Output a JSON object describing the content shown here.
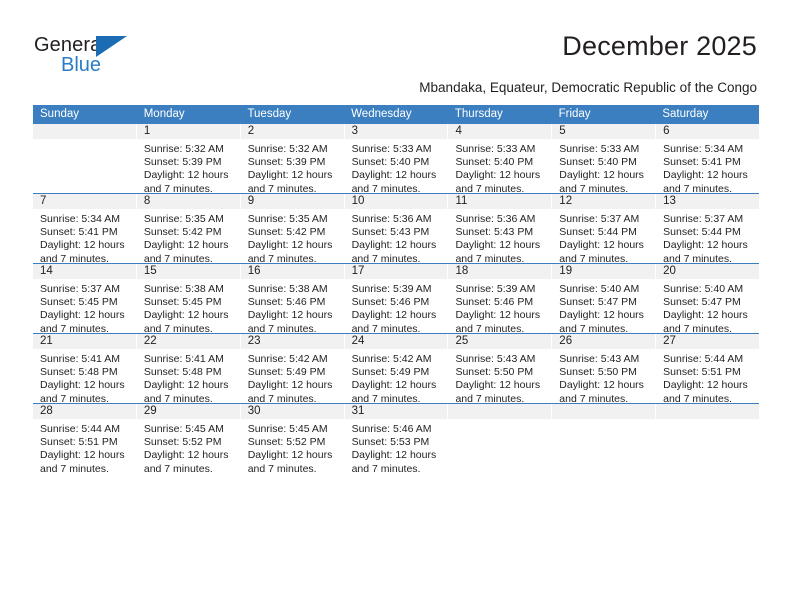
{
  "brand": {
    "name_top": "General",
    "name_bottom": "Blue",
    "accent_color": "#1b6cb3",
    "triangle_icon": "triangle-icon"
  },
  "header": {
    "title": "December 2025",
    "subtitle": "Mbandaka, Equateur, Democratic Republic of the Congo"
  },
  "calendar": {
    "header_bg": "#3b7fc0",
    "daynum_bg": "#f1f1f1",
    "weekdays": [
      "Sunday",
      "Monday",
      "Tuesday",
      "Wednesday",
      "Thursday",
      "Friday",
      "Saturday"
    ],
    "weeks": [
      {
        "days": [
          {
            "num": "",
            "lines": []
          },
          {
            "num": "1",
            "lines": [
              "Sunrise: 5:32 AM",
              "Sunset: 5:39 PM",
              "Daylight: 12 hours",
              "and 7 minutes."
            ]
          },
          {
            "num": "2",
            "lines": [
              "Sunrise: 5:32 AM",
              "Sunset: 5:39 PM",
              "Daylight: 12 hours",
              "and 7 minutes."
            ]
          },
          {
            "num": "3",
            "lines": [
              "Sunrise: 5:33 AM",
              "Sunset: 5:40 PM",
              "Daylight: 12 hours",
              "and 7 minutes."
            ]
          },
          {
            "num": "4",
            "lines": [
              "Sunrise: 5:33 AM",
              "Sunset: 5:40 PM",
              "Daylight: 12 hours",
              "and 7 minutes."
            ]
          },
          {
            "num": "5",
            "lines": [
              "Sunrise: 5:33 AM",
              "Sunset: 5:40 PM",
              "Daylight: 12 hours",
              "and 7 minutes."
            ]
          },
          {
            "num": "6",
            "lines": [
              "Sunrise: 5:34 AM",
              "Sunset: 5:41 PM",
              "Daylight: 12 hours",
              "and 7 minutes."
            ]
          }
        ]
      },
      {
        "days": [
          {
            "num": "7",
            "lines": [
              "Sunrise: 5:34 AM",
              "Sunset: 5:41 PM",
              "Daylight: 12 hours",
              "and 7 minutes."
            ]
          },
          {
            "num": "8",
            "lines": [
              "Sunrise: 5:35 AM",
              "Sunset: 5:42 PM",
              "Daylight: 12 hours",
              "and 7 minutes."
            ]
          },
          {
            "num": "9",
            "lines": [
              "Sunrise: 5:35 AM",
              "Sunset: 5:42 PM",
              "Daylight: 12 hours",
              "and 7 minutes."
            ]
          },
          {
            "num": "10",
            "lines": [
              "Sunrise: 5:36 AM",
              "Sunset: 5:43 PM",
              "Daylight: 12 hours",
              "and 7 minutes."
            ]
          },
          {
            "num": "11",
            "lines": [
              "Sunrise: 5:36 AM",
              "Sunset: 5:43 PM",
              "Daylight: 12 hours",
              "and 7 minutes."
            ]
          },
          {
            "num": "12",
            "lines": [
              "Sunrise: 5:37 AM",
              "Sunset: 5:44 PM",
              "Daylight: 12 hours",
              "and 7 minutes."
            ]
          },
          {
            "num": "13",
            "lines": [
              "Sunrise: 5:37 AM",
              "Sunset: 5:44 PM",
              "Daylight: 12 hours",
              "and 7 minutes."
            ]
          }
        ]
      },
      {
        "days": [
          {
            "num": "14",
            "lines": [
              "Sunrise: 5:37 AM",
              "Sunset: 5:45 PM",
              "Daylight: 12 hours",
              "and 7 minutes."
            ]
          },
          {
            "num": "15",
            "lines": [
              "Sunrise: 5:38 AM",
              "Sunset: 5:45 PM",
              "Daylight: 12 hours",
              "and 7 minutes."
            ]
          },
          {
            "num": "16",
            "lines": [
              "Sunrise: 5:38 AM",
              "Sunset: 5:46 PM",
              "Daylight: 12 hours",
              "and 7 minutes."
            ]
          },
          {
            "num": "17",
            "lines": [
              "Sunrise: 5:39 AM",
              "Sunset: 5:46 PM",
              "Daylight: 12 hours",
              "and 7 minutes."
            ]
          },
          {
            "num": "18",
            "lines": [
              "Sunrise: 5:39 AM",
              "Sunset: 5:46 PM",
              "Daylight: 12 hours",
              "and 7 minutes."
            ]
          },
          {
            "num": "19",
            "lines": [
              "Sunrise: 5:40 AM",
              "Sunset: 5:47 PM",
              "Daylight: 12 hours",
              "and 7 minutes."
            ]
          },
          {
            "num": "20",
            "lines": [
              "Sunrise: 5:40 AM",
              "Sunset: 5:47 PM",
              "Daylight: 12 hours",
              "and 7 minutes."
            ]
          }
        ]
      },
      {
        "days": [
          {
            "num": "21",
            "lines": [
              "Sunrise: 5:41 AM",
              "Sunset: 5:48 PM",
              "Daylight: 12 hours",
              "and 7 minutes."
            ]
          },
          {
            "num": "22",
            "lines": [
              "Sunrise: 5:41 AM",
              "Sunset: 5:48 PM",
              "Daylight: 12 hours",
              "and 7 minutes."
            ]
          },
          {
            "num": "23",
            "lines": [
              "Sunrise: 5:42 AM",
              "Sunset: 5:49 PM",
              "Daylight: 12 hours",
              "and 7 minutes."
            ]
          },
          {
            "num": "24",
            "lines": [
              "Sunrise: 5:42 AM",
              "Sunset: 5:49 PM",
              "Daylight: 12 hours",
              "and 7 minutes."
            ]
          },
          {
            "num": "25",
            "lines": [
              "Sunrise: 5:43 AM",
              "Sunset: 5:50 PM",
              "Daylight: 12 hours",
              "and 7 minutes."
            ]
          },
          {
            "num": "26",
            "lines": [
              "Sunrise: 5:43 AM",
              "Sunset: 5:50 PM",
              "Daylight: 12 hours",
              "and 7 minutes."
            ]
          },
          {
            "num": "27",
            "lines": [
              "Sunrise: 5:44 AM",
              "Sunset: 5:51 PM",
              "Daylight: 12 hours",
              "and 7 minutes."
            ]
          }
        ]
      },
      {
        "days": [
          {
            "num": "28",
            "lines": [
              "Sunrise: 5:44 AM",
              "Sunset: 5:51 PM",
              "Daylight: 12 hours",
              "and 7 minutes."
            ]
          },
          {
            "num": "29",
            "lines": [
              "Sunrise: 5:45 AM",
              "Sunset: 5:52 PM",
              "Daylight: 12 hours",
              "and 7 minutes."
            ]
          },
          {
            "num": "30",
            "lines": [
              "Sunrise: 5:45 AM",
              "Sunset: 5:52 PM",
              "Daylight: 12 hours",
              "and 7 minutes."
            ]
          },
          {
            "num": "31",
            "lines": [
              "Sunrise: 5:46 AM",
              "Sunset: 5:53 PM",
              "Daylight: 12 hours",
              "and 7 minutes."
            ]
          },
          {
            "num": "",
            "lines": []
          },
          {
            "num": "",
            "lines": []
          },
          {
            "num": "",
            "lines": []
          }
        ]
      }
    ]
  }
}
